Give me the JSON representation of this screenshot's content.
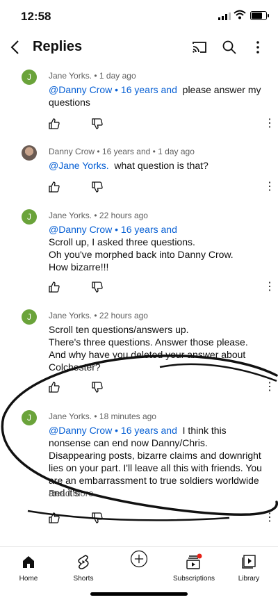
{
  "status_bar": {
    "time": "12:58"
  },
  "header": {
    "title": "Replies"
  },
  "comments": [
    {
      "author": "Jane Yorks.",
      "age": "1 day ago",
      "mention": "@Danny Crow • 16 years and",
      "text": "please answer my questions",
      "avatar_letter": "J"
    },
    {
      "author": "Danny Crow",
      "age": "16 years and • 1 day ago",
      "mention": "@Jane Yorks.",
      "text": "what question is that?"
    },
    {
      "author": "Jane Yorks.",
      "age": "22 hours ago",
      "mention": "@Danny Crow • 16 years and",
      "text": "Scroll up, I asked three questions.\nOh you've morphed back into Danny Crow.\nHow bizarre!!!",
      "avatar_letter": "J"
    },
    {
      "author": "Jane Yorks.",
      "age": "22 hours ago",
      "text": "Scroll ten questions/answers up.\nThere's three questions. Answer those please.\nAnd why have you deleted your answer about Colchester?",
      "avatar_letter": "J"
    },
    {
      "author": "Jane Yorks.",
      "age": "18 minutes ago",
      "mention": "@Danny Crow • 16 years and",
      "text": "I think this nonsense can end now Danny/Chris. Disappearing posts, bizarre claims and downright lies on your part. I'll leave all this with friends. You are an embarrassment to true soldiers worldwide and it's",
      "read_more": "Read more",
      "avatar_letter": "J"
    }
  ],
  "nav": {
    "home": "Home",
    "shorts": "Shorts",
    "subscriptions": "Subscriptions",
    "library": "Library"
  },
  "colors": {
    "accent": "#065fd4",
    "avatar_green": "#6aa33a",
    "notification_dot": "#e62117"
  }
}
